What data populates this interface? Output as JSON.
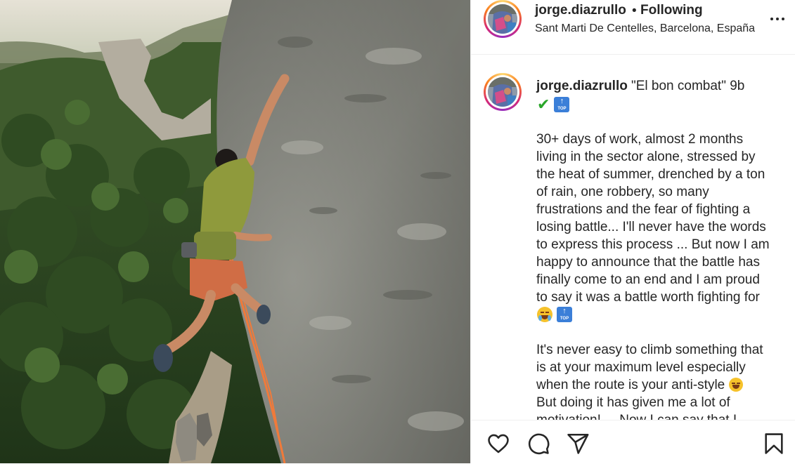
{
  "post": {
    "username": "jorge.diazrullo",
    "follow_separator": "•",
    "follow_status": "Following",
    "location": "Sant Marti De Centelles, Barcelona, España",
    "more_icon": "more-options-icon"
  },
  "caption": {
    "username": "jorge.diazrullo",
    "title": "\"El bon combat\" 9b",
    "title_emojis": [
      "check-mark-emoji",
      "top-arrow-emoji"
    ],
    "top_label": "TOP",
    "paragraph1_lines": [
      "30+ days of work, almost 2 months",
      "living in the sector alone, stressed by",
      "the heat of summer, drenched by a ton",
      "of rain, one robbery, so many",
      "frustrations and the fear of fighting a",
      "losing battle... I'll never have the words",
      "to express this process ... But now I am",
      "happy to announce that the battle has",
      "finally come to an end and I am proud",
      "to say it was a battle worth fighting for"
    ],
    "paragraph1_emojis": [
      "crying-face-emoji",
      "top-arrow-emoji"
    ],
    "paragraph2_lines": [
      "It's never easy to climb something that",
      "is at your maximum level especially",
      "when the route is your anti-style",
      "But doing it has given me a lot of",
      "motivation! ... Now I can say that I"
    ]
  },
  "actions": {
    "like_icon": "heart-icon",
    "comment_icon": "comment-icon",
    "share_icon": "share-icon",
    "save_icon": "bookmark-icon"
  },
  "colors": {
    "text": "#262626",
    "divider": "#efefef",
    "story_ring": "#d62976",
    "check_green": "#2aa62a",
    "top_blue": "#3b7fd8"
  }
}
